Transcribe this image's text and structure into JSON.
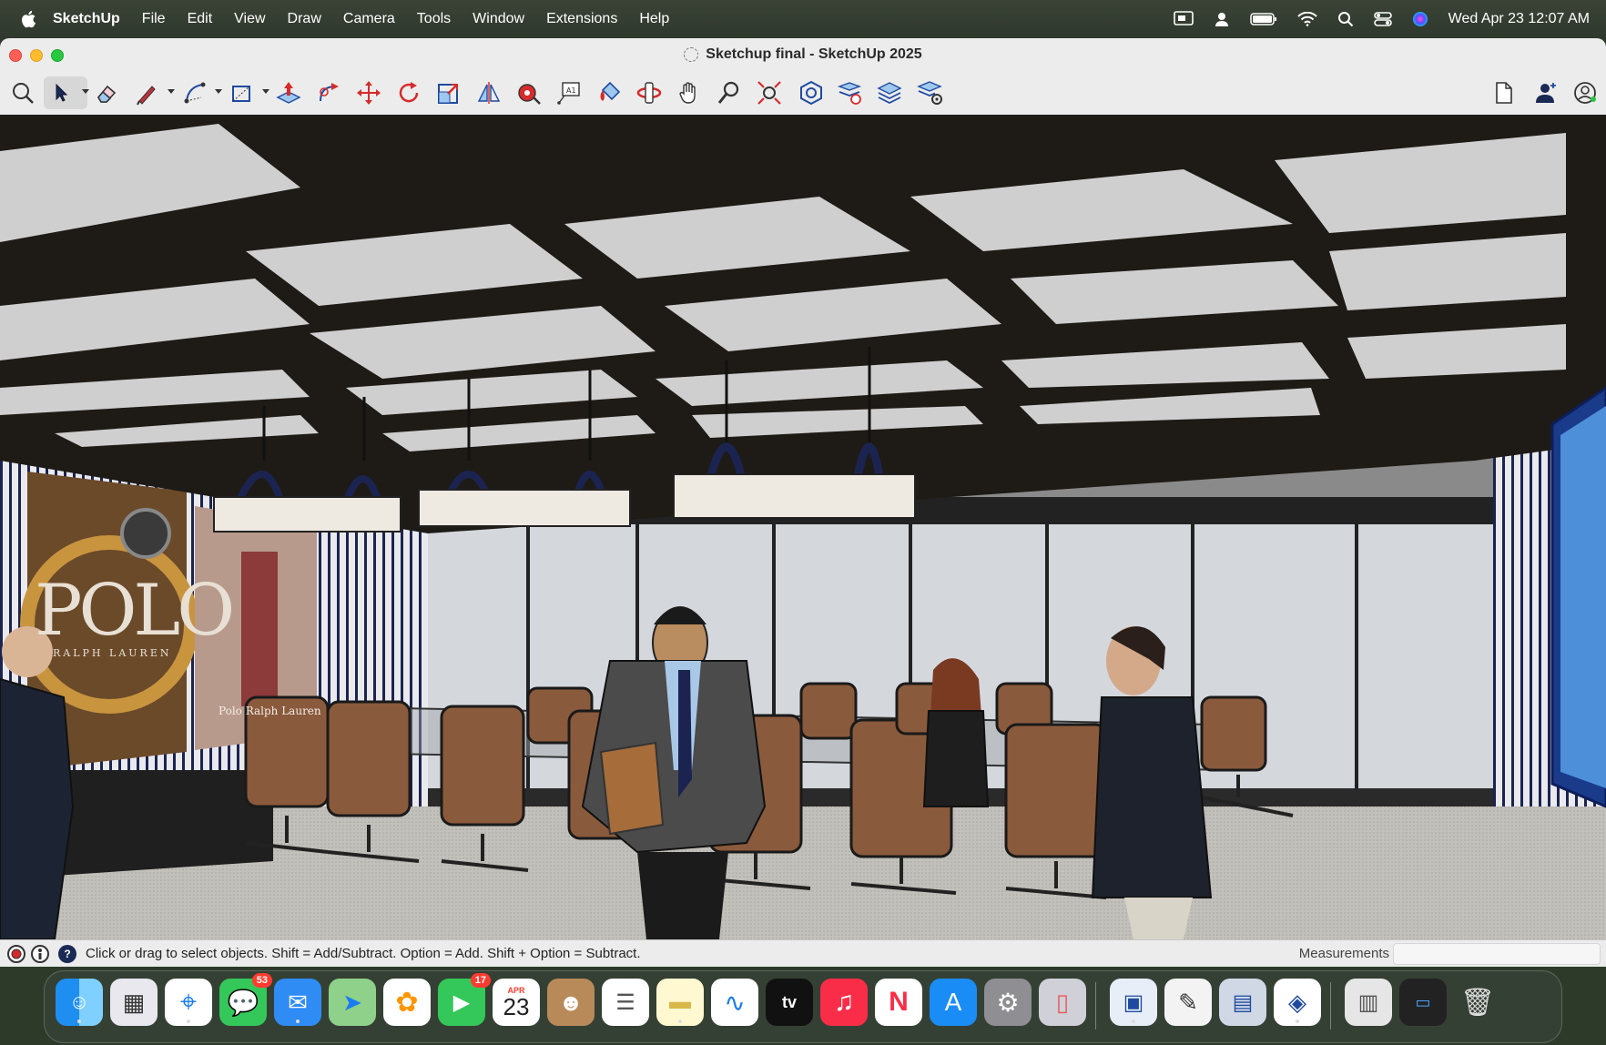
{
  "menubar": {
    "app_name": "SketchUp",
    "items": [
      "File",
      "Edit",
      "View",
      "Draw",
      "Camera",
      "Tools",
      "Window",
      "Extensions",
      "Help"
    ],
    "clock": "Wed Apr 23  12:07 AM"
  },
  "window": {
    "title": "Sketchup final - SketchUp 2025"
  },
  "toolbar": {
    "tools": [
      "search-tool",
      "select-tool",
      "eraser-tool",
      "line-tool",
      "arc-tool",
      "rectangle-tool",
      "push-pull-tool",
      "follow-me-tool",
      "move-tool",
      "rotate-tool",
      "scale-tool",
      "flip-tool",
      "tape-measure-tool",
      "text-tool",
      "paint-bucket-tool",
      "orbit-tool",
      "pan-tool",
      "zoom-tool",
      "zoom-extents-tool",
      "warehouse-tool",
      "extension-warehouse-tool",
      "layers-tool",
      "layers-settings-tool"
    ],
    "active_tool": "select-tool"
  },
  "scene": {
    "poster_left_title": "POLO",
    "poster_left_sub": "RALPH LAUREN",
    "poster_right_text": "Polo Ralph Lauren"
  },
  "statusbar": {
    "hint": "Click or drag to select objects. Shift = Add/Subtract. Option = Add. Shift + Option = Subtract.",
    "measurements_label": "Measurements",
    "measurements_value": ""
  },
  "dock": {
    "messages_badge": "53",
    "facetime_badge": "17",
    "calendar_month": "APR",
    "calendar_day": "23",
    "tv_label": "tv"
  },
  "colors": {
    "menubar_bg": "#2f382c",
    "window_bg": "#ececec",
    "ceiling_beam": "#1e1a16",
    "chair_leather": "#8a5a3c",
    "ceiling_panel": "#cfcfcf"
  }
}
